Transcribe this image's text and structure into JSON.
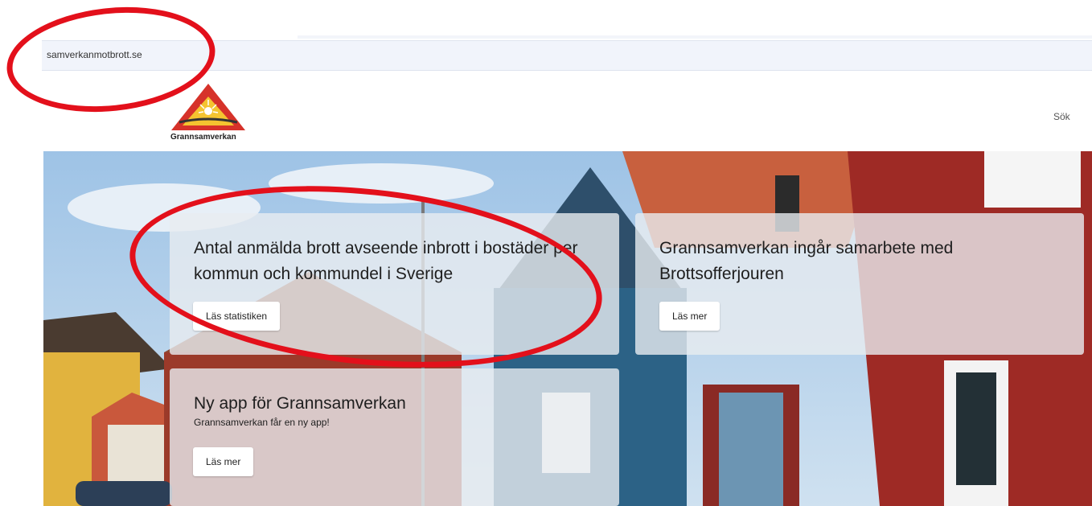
{
  "browser": {
    "url": "samverkanmotbrott.se"
  },
  "header": {
    "logo_text": "Grannsamverkan",
    "search_label": "Sök"
  },
  "cards": [
    {
      "title": "Antal anmälda brott avseende inbrott i bostäder per kommun och kommundel i Sverige",
      "button": "Läs statistiken"
    },
    {
      "title": "Grannsamverkan ingår samarbete med Brottsofferjouren",
      "button": "Läs mer"
    },
    {
      "title": "Ny app för Grannsamverkan",
      "subtitle": "Grannsamverkan får en ny app!",
      "button": "Läs mer"
    }
  ],
  "colors": {
    "annotation": "#e3101b",
    "logo_red": "#d6322a",
    "logo_yellow": "#f4c430"
  }
}
